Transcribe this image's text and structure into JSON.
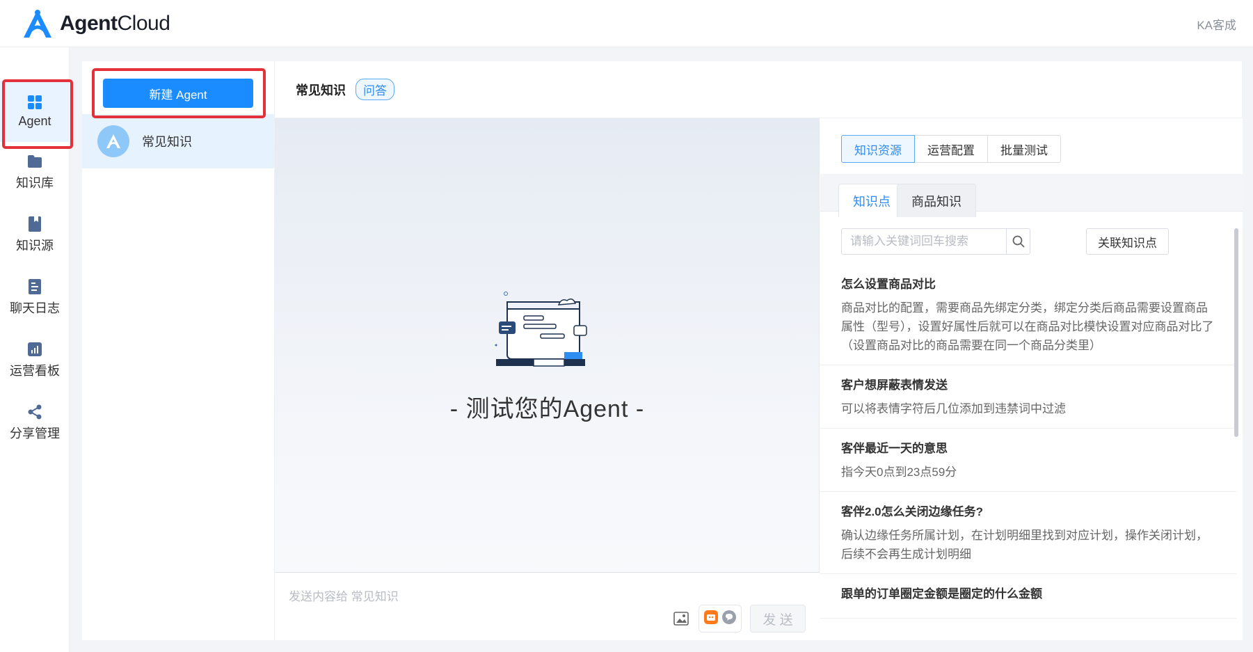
{
  "app": {
    "brand_bold": "Agent",
    "brand_light": "Cloud",
    "user": "KA客成"
  },
  "nav": [
    {
      "label": "Agent",
      "icon": "grid-icon"
    },
    {
      "label": "知识库",
      "icon": "folder-icon"
    },
    {
      "label": "知识源",
      "icon": "book-icon"
    },
    {
      "label": "聊天日志",
      "icon": "log-icon"
    },
    {
      "label": "运营看板",
      "icon": "chart-icon"
    },
    {
      "label": "分享管理",
      "icon": "share-icon"
    }
  ],
  "agents": {
    "new_button": "新建 Agent",
    "items": [
      {
        "name": "常见知识"
      }
    ]
  },
  "main": {
    "title": "常见知识",
    "tag": "问答"
  },
  "chat": {
    "empty_text": "- 测试您的Agent -",
    "input_placeholder": "发送内容给 常见知识",
    "send_label": "发 送"
  },
  "panel": {
    "tabs": [
      "知识资源",
      "运营配置",
      "批量测试"
    ],
    "subtabs": [
      "知识点",
      "商品知识"
    ],
    "search_placeholder": "请输入关键词回车搜索",
    "link_button": "关联知识点",
    "items": [
      {
        "q": "怎么设置商品对比",
        "a": "商品对比的配置，需要商品先绑定分类，绑定分类后商品需要设置商品属性（型号），设置好属性后就可以在商品对比模快设置对应商品对比了（设置商品对比的商品需要在同一个商品分类里）"
      },
      {
        "q": "客户想屏蔽表情发送",
        "a": "可以将表情字符后几位添加到违禁词中过滤"
      },
      {
        "q": "客伴最近一天的意思",
        "a": "指今天0点到23点59分"
      },
      {
        "q": "客伴2.0怎么关闭边缘任务?",
        "a": "确认边缘任务所属计划，在计划明细里找到对应计划，操作关闭计划，后续不会再生成计划明细"
      },
      {
        "q": "跟单的订单圈定金额是圈定的什么金额",
        "a": ""
      }
    ]
  },
  "colors": {
    "primary": "#1a8cff",
    "highlight": "#e2313b",
    "active_bg": "#e6f3ff"
  }
}
